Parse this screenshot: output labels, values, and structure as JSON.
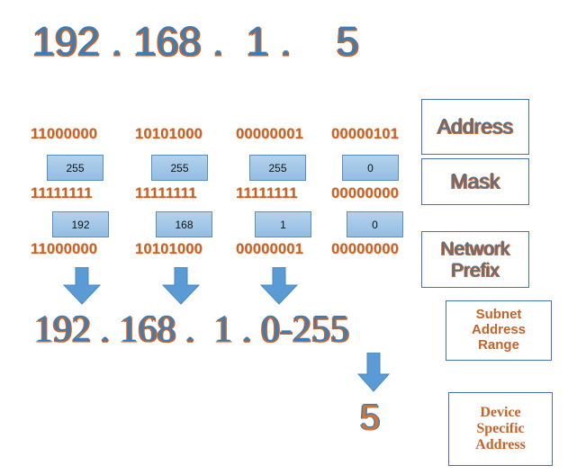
{
  "diagram": {
    "title_ip": "192 . 168 .  1 .    5",
    "result_ip": "192 . 168 .  1 . 0-255",
    "device_digit": "5",
    "colors": {
      "ip_text_blue": "#3f7cb4",
      "ip_shadow_orange": "#c4632a",
      "binary_orange": "#c4632a",
      "box_fill_blue": "#9dc3e6",
      "box_border_blue": "#5b8fc4",
      "arrow_blue": "#5b9bd5",
      "label_border_blue": "#4472b8",
      "label_text_blue_gray": "#56708c"
    },
    "octets": [
      {
        "address_binary": "11000000",
        "address_value": "255",
        "mask_binary": "11111111",
        "prefix_value": "192",
        "prefix_binary": "11000000",
        "result": "192"
      },
      {
        "address_binary": "10101000",
        "address_value": "255",
        "mask_binary": "11111111",
        "prefix_value": "168",
        "prefix_binary": "10101000",
        "result": "168"
      },
      {
        "address_binary": "00000001",
        "address_value": "255",
        "mask_binary": "11111111",
        "prefix_value": "1",
        "prefix_binary": "00000001",
        "result": "1"
      },
      {
        "address_binary": "00000101",
        "address_value": "0",
        "mask_binary": "00000000",
        "prefix_value": "0",
        "prefix_binary": "00000000",
        "result": "0-255"
      }
    ],
    "labels": {
      "address": "Address",
      "mask": "Mask",
      "network_prefix_line1": "Network",
      "network_prefix_line2": "Prefix",
      "subnet_range_line1": "Subnet",
      "subnet_range_line2": "Address",
      "subnet_range_line3": "Range",
      "device_line1": "Device",
      "device_line2": "Specific",
      "device_line3": "Address"
    }
  }
}
